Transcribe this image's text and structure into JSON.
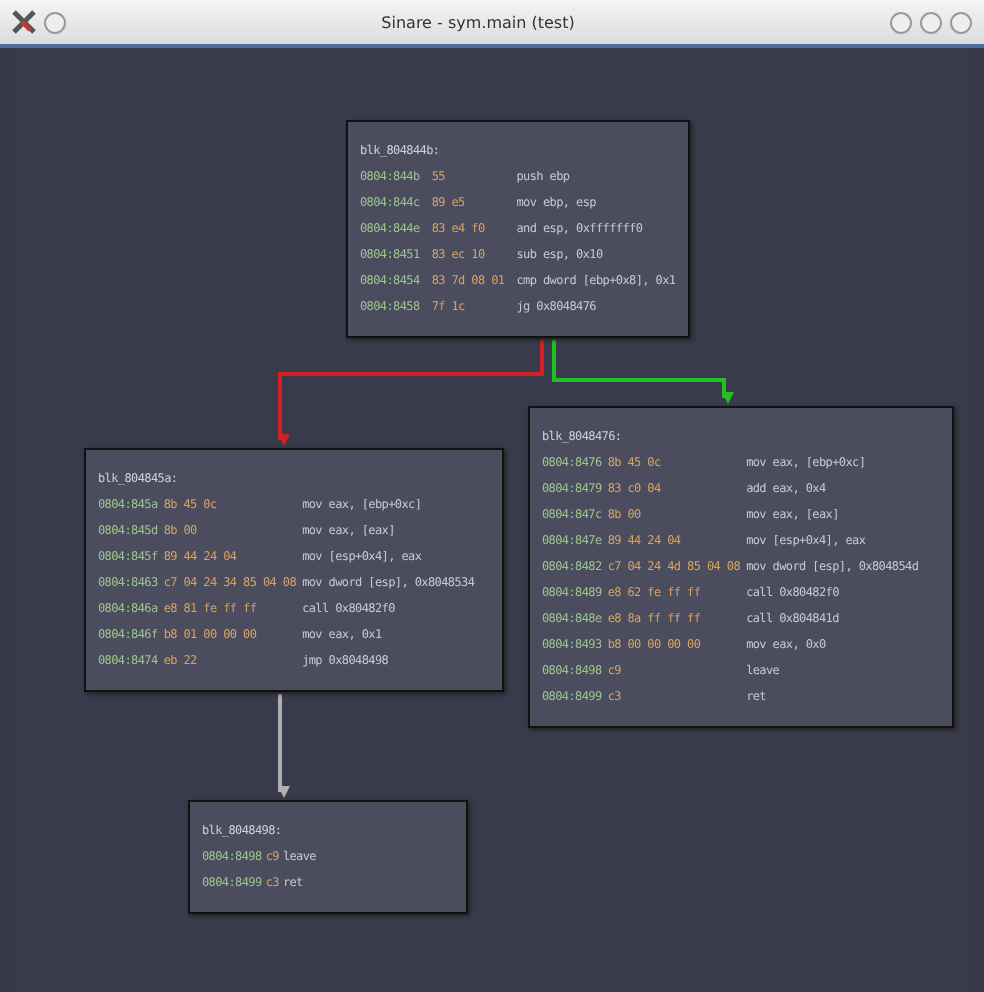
{
  "window": {
    "title": "Sinare - sym.main (test)"
  },
  "blocks": [
    {
      "label": "blk_804844b:",
      "lines": [
        {
          "address": "0804:844b",
          "bytes": "55",
          "instruction": "push ebp"
        },
        {
          "address": "0804:844c",
          "bytes": "89 e5",
          "instruction": "mov ebp, esp"
        },
        {
          "address": "0804:844e",
          "bytes": "83 e4 f0",
          "instruction": "and esp, 0xfffffff0"
        },
        {
          "address": "0804:8451",
          "bytes": "83 ec 10",
          "instruction": "sub esp, 0x10"
        },
        {
          "address": "0804:8454",
          "bytes": "83 7d 08 01",
          "instruction": "cmp dword [ebp+0x8], 0x1"
        },
        {
          "address": "0804:8458",
          "bytes": "7f 1c",
          "instruction": "jg 0x8048476"
        }
      ]
    },
    {
      "label": "blk_804845a:",
      "lines": [
        {
          "address": "0804:845a",
          "bytes": "8b 45 0c",
          "instruction": "mov eax, [ebp+0xc]"
        },
        {
          "address": "0804:845d",
          "bytes": "8b 00",
          "instruction": "mov eax, [eax]"
        },
        {
          "address": "0804:845f",
          "bytes": "89 44 24 04",
          "instruction": "mov [esp+0x4], eax"
        },
        {
          "address": "0804:8463",
          "bytes": "c7 04 24 34 85 04 08",
          "instruction": "mov dword [esp], 0x8048534"
        },
        {
          "address": "0804:846a",
          "bytes": "e8 81 fe ff ff",
          "instruction": "call 0x80482f0"
        },
        {
          "address": "0804:846f",
          "bytes": "b8 01 00 00 00",
          "instruction": "mov eax, 0x1"
        },
        {
          "address": "0804:8474",
          "bytes": "eb 22",
          "instruction": "jmp 0x8048498"
        }
      ]
    },
    {
      "label": "blk_8048476:",
      "lines": [
        {
          "address": "0804:8476",
          "bytes": "8b 45 0c",
          "instruction": "mov eax, [ebp+0xc]"
        },
        {
          "address": "0804:8479",
          "bytes": "83 c0 04",
          "instruction": "add eax, 0x4"
        },
        {
          "address": "0804:847c",
          "bytes": "8b 00",
          "instruction": "mov eax, [eax]"
        },
        {
          "address": "0804:847e",
          "bytes": "89 44 24 04",
          "instruction": "mov [esp+0x4], eax"
        },
        {
          "address": "0804:8482",
          "bytes": "c7 04 24 4d 85 04 08",
          "instruction": "mov dword [esp], 0x804854d"
        },
        {
          "address": "0804:8489",
          "bytes": "e8 62 fe ff ff",
          "instruction": "call 0x80482f0"
        },
        {
          "address": "0804:848e",
          "bytes": "e8 8a ff ff ff",
          "instruction": "call 0x804841d"
        },
        {
          "address": "0804:8493",
          "bytes": "b8 00 00 00 00",
          "instruction": "mov eax, 0x0"
        },
        {
          "address": "0804:8498",
          "bytes": "c9",
          "instruction": "leave"
        },
        {
          "address": "0804:8499",
          "bytes": "c3",
          "instruction": "ret"
        }
      ]
    },
    {
      "label": "blk_8048498:",
      "lines": [
        {
          "address": "0804:8498",
          "bytes": "c9",
          "instruction": "leave"
        },
        {
          "address": "0804:8499",
          "bytes": "c3",
          "instruction": "ret"
        }
      ]
    }
  ],
  "edges": [
    {
      "kind": "false"
    },
    {
      "kind": "true"
    },
    {
      "kind": "unconditional"
    }
  ]
}
